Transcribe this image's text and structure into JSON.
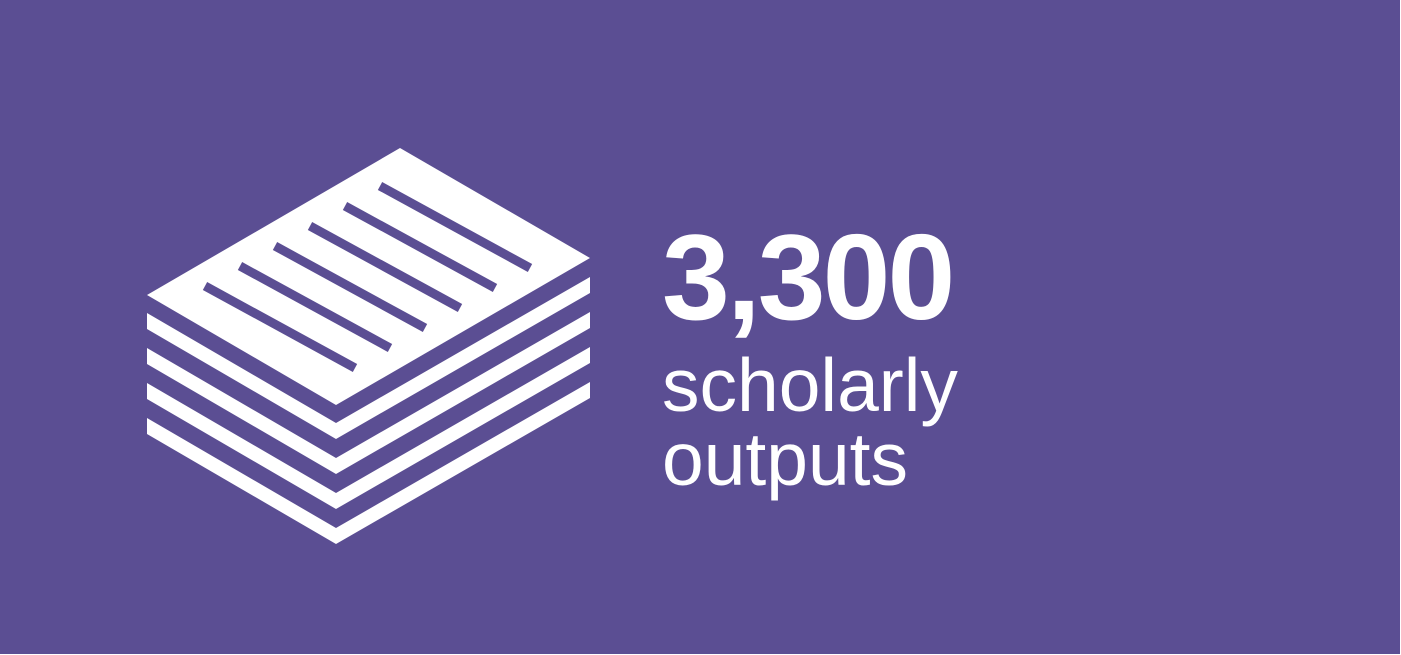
{
  "colors": {
    "background": "#5b4e93",
    "foreground": "#ffffff"
  },
  "icon": "stack-of-papers-icon",
  "stat": {
    "value": "3,300",
    "label_line1": "scholarly",
    "label_line2": "outputs"
  }
}
